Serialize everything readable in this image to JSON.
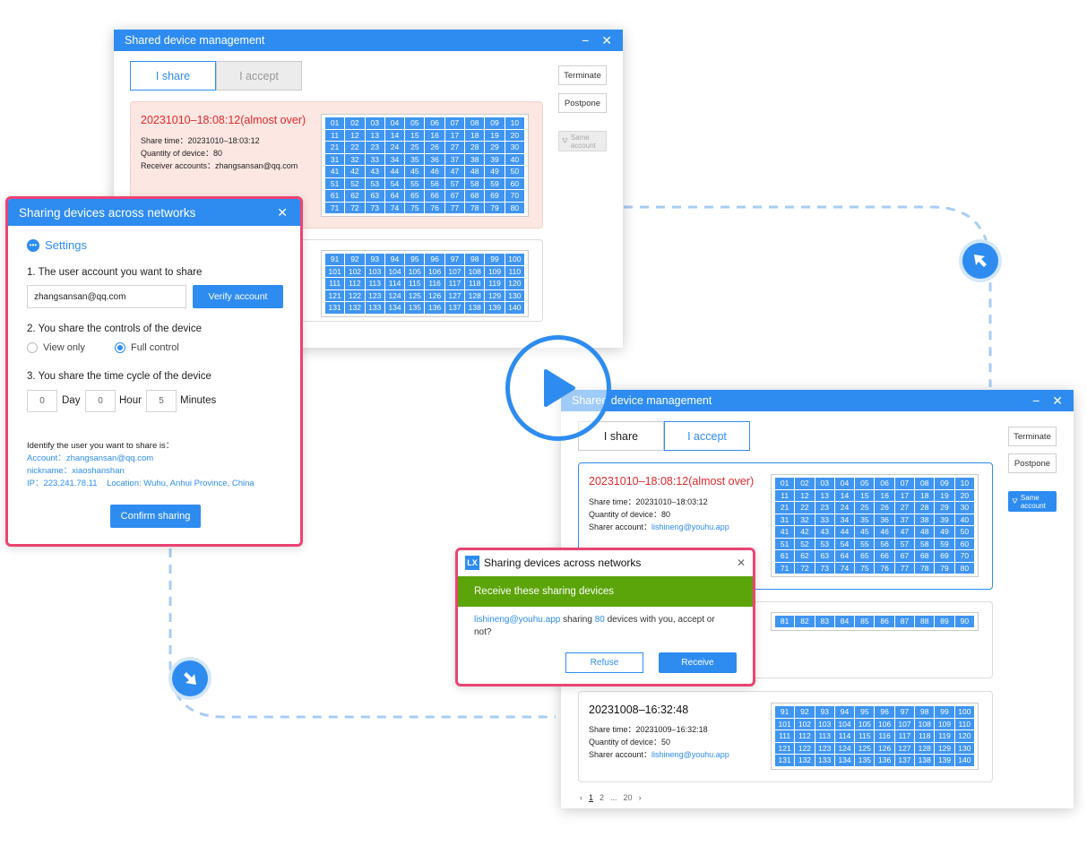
{
  "colors": {
    "accent": "#2e8cf0",
    "highlight_border": "#ec4373",
    "alert_red": "#e0292b",
    "green_banner": "#5ba40a",
    "card_pink": "#fce7e2"
  },
  "win1": {
    "title": "Shared device management",
    "tab_share": "I share",
    "tab_accept": "I accept",
    "terminate": "Terminate",
    "postpone": "Postpone",
    "same_account": "Same account",
    "card1": {
      "title": "20231010–18:08:12(almost over)",
      "share_time": "Share time：20231010–18:03:12",
      "quantity": "Quantity of device：80",
      "receiver": "Receiver accounts：zhangsansan@qq.com",
      "devices": [
        "01",
        "02",
        "03",
        "04",
        "05",
        "06",
        "07",
        "08",
        "09",
        "10",
        "11",
        "12",
        "13",
        "14",
        "15",
        "16",
        "17",
        "18",
        "19",
        "20",
        "21",
        "22",
        "23",
        "24",
        "25",
        "26",
        "27",
        "28",
        "29",
        "30",
        "31",
        "32",
        "33",
        "34",
        "35",
        "36",
        "37",
        "38",
        "39",
        "40",
        "41",
        "42",
        "43",
        "44",
        "45",
        "46",
        "47",
        "48",
        "49",
        "50",
        "51",
        "52",
        "53",
        "54",
        "55",
        "56",
        "57",
        "58",
        "59",
        "60",
        "61",
        "62",
        "63",
        "64",
        "65",
        "66",
        "67",
        "68",
        "69",
        "70",
        "71",
        "72",
        "73",
        "74",
        "75",
        "76",
        "77",
        "78",
        "79",
        "80"
      ]
    },
    "card2": {
      "devices": [
        "91",
        "92",
        "93",
        "94",
        "95",
        "96",
        "97",
        "98",
        "99",
        "100",
        "101",
        "102",
        "103",
        "104",
        "105",
        "106",
        "107",
        "108",
        "109",
        "110",
        "111",
        "112",
        "113",
        "114",
        "115",
        "116",
        "117",
        "118",
        "119",
        "120",
        "121",
        "122",
        "123",
        "124",
        "125",
        "126",
        "127",
        "128",
        "129",
        "130",
        "131",
        "132",
        "133",
        "134",
        "135",
        "136",
        "137",
        "138",
        "139",
        "140"
      ]
    }
  },
  "win2": {
    "title": "Shared device management",
    "tab_share": "I share",
    "tab_accept": "I accept",
    "terminate": "Terminate",
    "postpone": "Postpone",
    "same_account": "Same account",
    "card1": {
      "title": "20231010–18:08:12(almost over)",
      "share_time": "Share time：20231010–18:03:12",
      "quantity": "Quantity of device：80",
      "sharer_label": "Sharer account：",
      "sharer_value": "lishineng@youhu.app",
      "devices": [
        "01",
        "02",
        "03",
        "04",
        "05",
        "06",
        "07",
        "08",
        "09",
        "10",
        "11",
        "12",
        "13",
        "14",
        "15",
        "16",
        "17",
        "18",
        "19",
        "20",
        "21",
        "22",
        "23",
        "24",
        "25",
        "26",
        "27",
        "28",
        "29",
        "30",
        "31",
        "32",
        "33",
        "34",
        "35",
        "36",
        "37",
        "38",
        "39",
        "40",
        "41",
        "42",
        "43",
        "44",
        "45",
        "46",
        "47",
        "48",
        "49",
        "50",
        "51",
        "52",
        "53",
        "54",
        "55",
        "56",
        "57",
        "58",
        "59",
        "60",
        "61",
        "62",
        "63",
        "64",
        "65",
        "66",
        "67",
        "68",
        "69",
        "70",
        "71",
        "72",
        "73",
        "74",
        "75",
        "76",
        "77",
        "78",
        "79",
        "80"
      ]
    },
    "card2": {
      "devices": [
        "81",
        "82",
        "83",
        "84",
        "85",
        "86",
        "87",
        "88",
        "89",
        "90"
      ]
    },
    "card3": {
      "title": "20231008–16:32:48",
      "share_time": "Share time：20231009–16:32:18",
      "quantity": "Quantity of device：50",
      "sharer_label": "Sharer account：",
      "sharer_value": "lishineng@youhu.app",
      "devices": [
        "91",
        "92",
        "93",
        "94",
        "95",
        "96",
        "97",
        "98",
        "99",
        "100",
        "101",
        "102",
        "103",
        "104",
        "105",
        "106",
        "107",
        "108",
        "109",
        "110",
        "111",
        "112",
        "113",
        "114",
        "115",
        "116",
        "117",
        "118",
        "119",
        "120",
        "121",
        "122",
        "123",
        "124",
        "125",
        "126",
        "127",
        "128",
        "129",
        "130",
        "131",
        "132",
        "133",
        "134",
        "135",
        "136",
        "137",
        "138",
        "139",
        "140"
      ]
    },
    "pagination": {
      "prev": "‹",
      "p1": "1",
      "p2": "2",
      "ellipsis": "...",
      "last": "20",
      "next": "›"
    }
  },
  "share_dialog": {
    "title": "Sharing devices across networks",
    "close": "✕",
    "settings": "Settings",
    "step1": "1. The user account you want to share",
    "account_value": "zhangsansan@qq.com",
    "verify": "Verify account",
    "step2": "2. You share the controls of the device",
    "view_only": "View only",
    "full_control": "Full control",
    "selected_control": "Full control",
    "step3": "3. You share the time cycle of the device",
    "day_value": "0",
    "day_label": "Day",
    "hour_value": "0",
    "hour_label": "Hour",
    "minute_value": "5",
    "minute_label": "Minutes",
    "identify": "Identify the user you want to share is：",
    "account_line": "Account：zhangsansan@qq.com",
    "nickname_line": "nickname：xiaoshanshan",
    "ip_line": "IP：223.241.78.11    Location: Wuhu, Anhui Province, China",
    "confirm": "Confirm sharing"
  },
  "receive_dialog": {
    "logo": "LX",
    "title": "Sharing devices across networks",
    "close": "✕",
    "banner": "Receive these sharing devices",
    "msg_user": "lishineng@youhu.app",
    "msg_mid": " sharing ",
    "msg_count": "80",
    "msg_end": " devices with you, accept or not?",
    "refuse": "Refuse",
    "receive": "Receive"
  }
}
